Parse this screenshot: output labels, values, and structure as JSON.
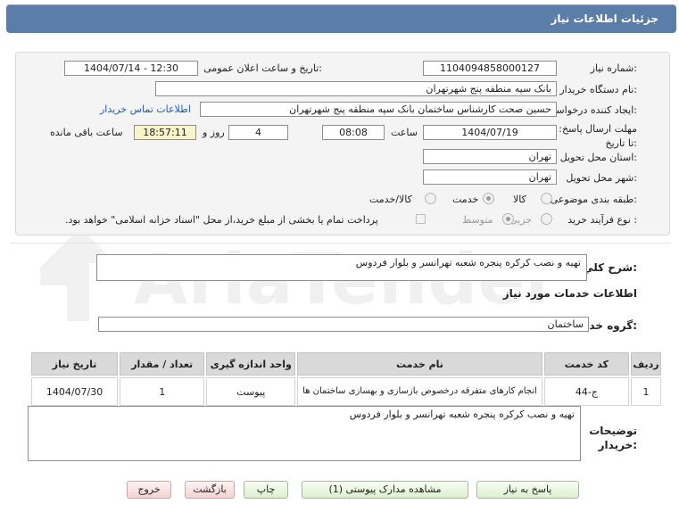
{
  "header": {
    "title": "جزئیات اطلاعات نیاز"
  },
  "form": {
    "need_number_label": "شماره نیاز:",
    "need_number": "1104094858000127",
    "announce_label": "تاریخ و ساعت اعلان عمومی:",
    "announce_value": "1404/07/14 - 12:30",
    "buyer_org_label": "نام دستگاه خریدار:",
    "buyer_org": "بانک سپه منطقه پنج شهرتهران",
    "creator_label": "ایجاد کننده درخواست:",
    "creator": "حسین صحت کارشناس ساختمان بانک سپه منطقه پنج شهرتهران",
    "contact_link": "اطلاعات تماس خریدار",
    "deadline_label": "مهلت ارسال پاسخ: تا تاریخ:",
    "deadline_date": "1404/07/19",
    "time_label": "ساعت",
    "deadline_time": "08:08",
    "days_value": "4",
    "days_label": "روز و",
    "remaining_time": "18:57:11",
    "remaining_label": "ساعت باقی مانده",
    "province_label": "استان محل تحویل:",
    "province": "تهران",
    "city_label": "شهر محل تحویل:",
    "city": "تهران",
    "category_label": "طبقه بندی موضوعی:",
    "category_options": [
      "کالا",
      "خدمت",
      "کالا/خدمت"
    ],
    "category_selected": "خدمت",
    "process_label": "نوع فرآیند خرید :",
    "process_options": [
      "جزیی",
      "متوسط"
    ],
    "process_selected": "متوسط",
    "payment_note": "پرداخت تمام یا بخشی از مبلغ خرید،از محل \"اسناد خزانه اسلامی\" خواهد بود."
  },
  "summary": {
    "label": "شرح کلي نياز:",
    "text": "تهیه و نصب کرکره پنجره شعبه تهرانسر و بلوار فردوس"
  },
  "services": {
    "section_title": "اطلاعات خدمات مورد نیاز",
    "group_label": "گروه خدمت:",
    "group_value": "ساختمان",
    "columns": [
      "ردیف",
      "کد خدمت",
      "نام خدمت",
      "واحد اندازه گیری",
      "تعداد / مقدار",
      "تاریخ نیاز"
    ],
    "rows": [
      {
        "index": "1",
        "code": "ج-44",
        "name": "انجام کارهای متفرقه درخصوص بازسازی و بهسازی ساختمان ها",
        "unit": "پیوست",
        "qty": "1",
        "date": "1404/07/30"
      }
    ]
  },
  "buyer_notes": {
    "label": "توضیحات خریدار:",
    "text": "تهیه و نصب کرکره پنجره شعبه تهرانسر و بلوار فردوس"
  },
  "buttons": {
    "reply": "پاسخ به نیاز",
    "docs": "مشاهده مدارک پیوستی (1)",
    "print": "چاپ",
    "back": "بازگشت",
    "exit": "خروج"
  },
  "watermark": {
    "text": "AriaTender.net"
  },
  "colors": {
    "header": "#5a7ea8",
    "panel": "#f4f4f4",
    "link": "#1f5bb5",
    "remaining_bg": "#f8f3c8"
  }
}
